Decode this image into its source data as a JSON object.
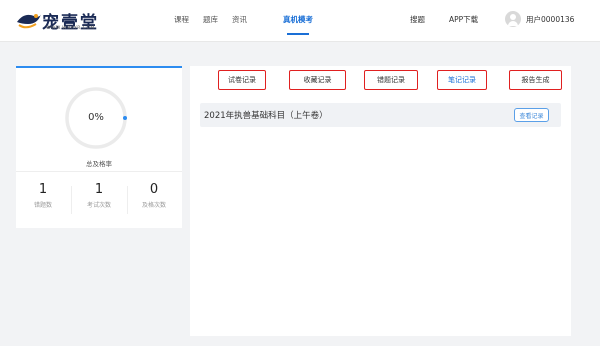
{
  "brand": {
    "name": "宠壹堂",
    "sub": "WWW.WBAYR.COM",
    "accent": "#1a6fd6",
    "alert": "#e02020"
  },
  "nav": {
    "items": [
      {
        "label": "课程"
      },
      {
        "label": "题库"
      },
      {
        "label": "资讯"
      },
      {
        "label": "真机模考"
      }
    ],
    "active": "真机模考",
    "right": {
      "search": "搜题",
      "app": "APP下载",
      "user": "用户0000136"
    }
  },
  "stats": {
    "pass_rate": "0%",
    "pass_rate_value": 0,
    "pass_rate_label": "总及格率",
    "items": [
      {
        "value": "1",
        "label": "错题数"
      },
      {
        "value": "1",
        "label": "考试次数"
      },
      {
        "value": "0",
        "label": "及格次数"
      }
    ]
  },
  "tabs": [
    {
      "label": "试卷记录"
    },
    {
      "label": "收藏记录"
    },
    {
      "label": "错题记录"
    },
    {
      "label": "笔记记录"
    },
    {
      "label": "报告生成"
    }
  ],
  "active_tab": "笔记记录",
  "records": [
    {
      "title": "2021年执兽基础科目（上午卷）",
      "action": "查看记录"
    }
  ]
}
